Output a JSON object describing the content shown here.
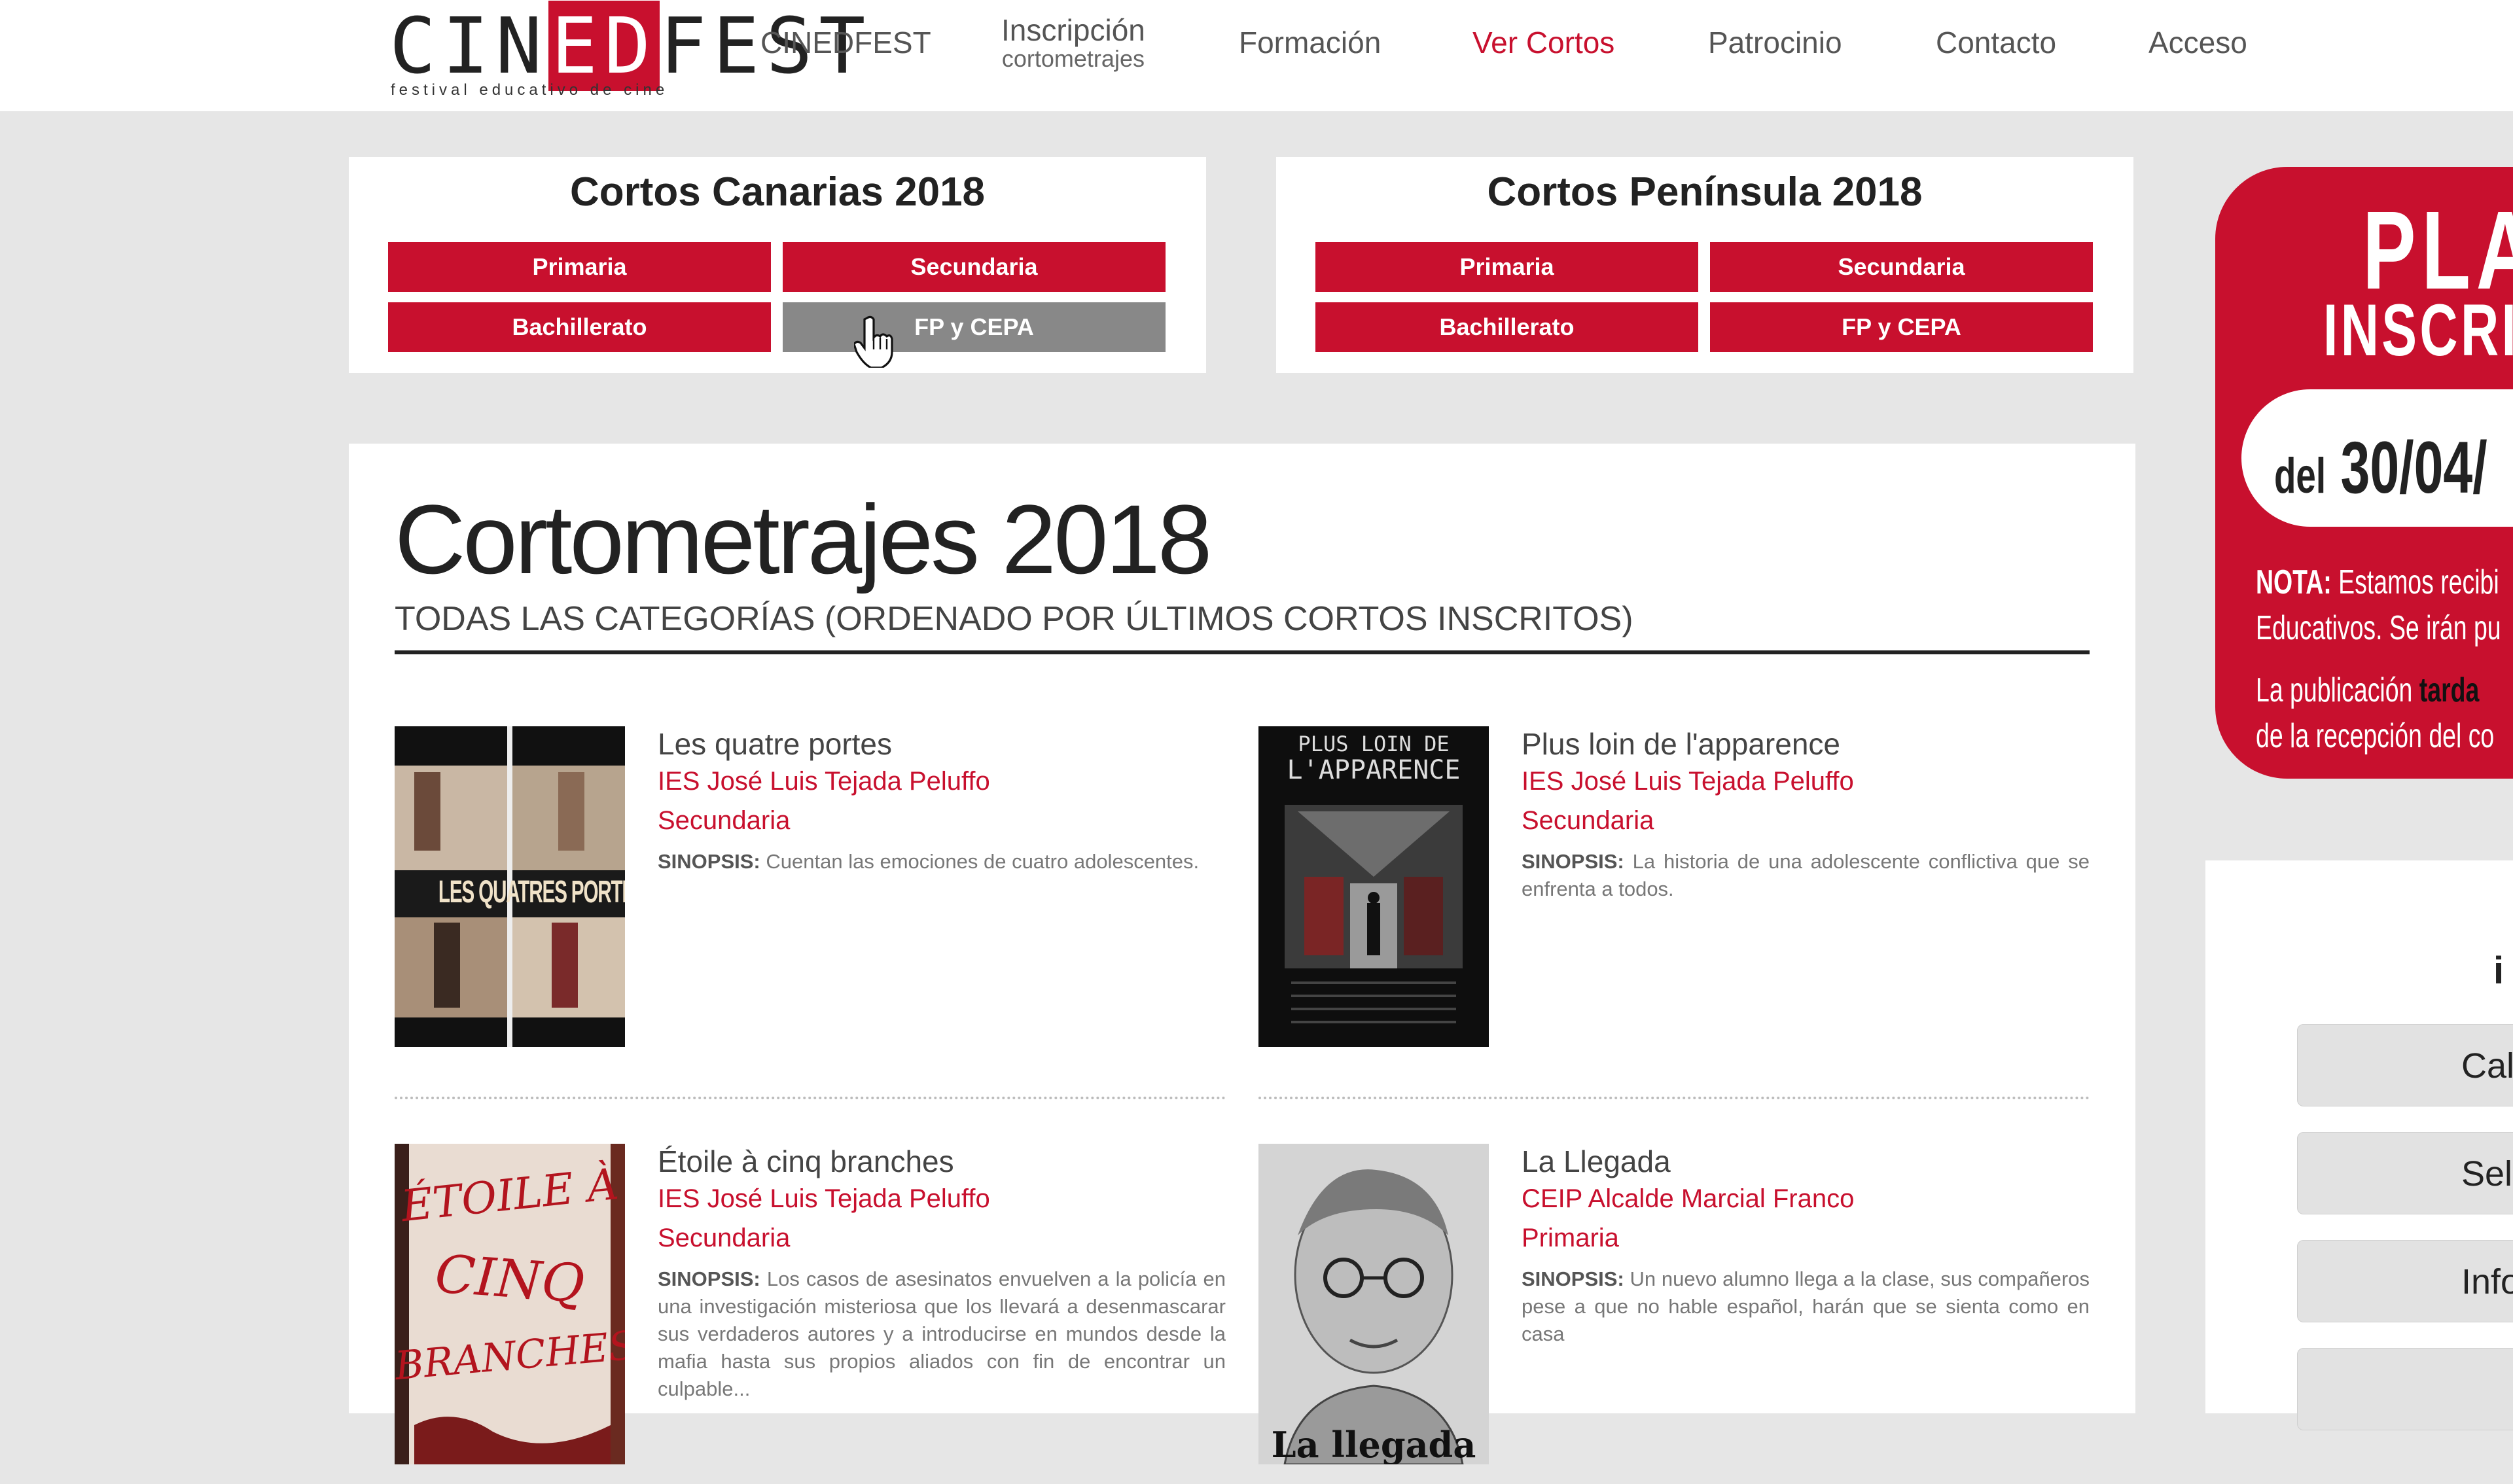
{
  "header": {
    "logo_main_pre": "CIN",
    "logo_main_ed": "ED",
    "logo_main_post": "FEST",
    "logo_sub": "festival educativo de cine",
    "nav": [
      {
        "label": "CINEDFEST"
      },
      {
        "label": "Inscripción",
        "sub": "cortometrajes"
      },
      {
        "label": "Formación"
      },
      {
        "label": "Ver Cortos",
        "active": true
      },
      {
        "label": "Patrocinio"
      },
      {
        "label": "Contacto"
      },
      {
        "label": "Acceso"
      }
    ]
  },
  "panels": [
    {
      "title": "Cortos Canarias 2018",
      "buttons": [
        "Primaria",
        "Secundaria",
        "Bachillerato",
        "FP y CEPA"
      ]
    },
    {
      "title": "Cortos Península 2018",
      "buttons": [
        "Primaria",
        "Secundaria",
        "Bachillerato",
        "FP y CEPA"
      ]
    }
  ],
  "main": {
    "title": "Cortometrajes 2018",
    "subtitle": "TODAS LAS CATEGORÍAS (ORDENADO POR ÚLTIMOS CORTOS INSCRITOS)",
    "synopsis_label": "SINOPSIS:",
    "entries": [
      {
        "title": "Les quatre portes",
        "school": "IES José Luis Tejada Peluffo",
        "level": "Secundaria",
        "synopsis": "Cuentan las emociones de cuatro adolescentes.",
        "poster_text": "LES QUATRES PORTES"
      },
      {
        "title": "Plus loin de l'apparence",
        "school": "IES José Luis Tejada Peluffo",
        "level": "Secundaria",
        "synopsis": "La historia de una adolescente conflictiva que se enfrenta a todos.",
        "poster_text_1": "PLUS LOIN DE",
        "poster_text_2": "L'APPARENCE"
      },
      {
        "title": "Étoile à cinq branches",
        "school": "IES José Luis Tejada Peluffo",
        "level": "Secundaria",
        "synopsis": "Los casos de asesinatos envuelven a la policía en una investigación misteriosa que los llevará a desenmascarar sus verdaderos autores y a introducirse en mundos desde la mafia hasta sus propios aliados con fin de encontrar un culpable...",
        "poster_text_1": "ÉTOILE À",
        "poster_text_2": "CINQ",
        "poster_text_3": "BRANCHES"
      },
      {
        "title": "La Llegada",
        "school": "CEIP Alcalde Marcial Franco",
        "level": "Primaria",
        "synopsis": "Un nuevo alumno llega a la clase, sus compañeros pese a que no hable español, harán que se sienta como en casa",
        "poster_text": "La llegada"
      }
    ]
  },
  "promo": {
    "title": "PLAZ",
    "sub": "INSCRIP",
    "date_prefix": "del",
    "date": "30/04/",
    "note_label": "NOTA:",
    "note_line1": "Estamos recibi",
    "note_line2": "Educativos. Se irán pu",
    "note2_pre": "La publicación",
    "note2_hl": "tarda",
    "note2_line2": "de la recepción del co"
  },
  "sidebar": {
    "heading": "i",
    "buttons": [
      "Cale",
      "Sele",
      "Info",
      ""
    ]
  },
  "colors": {
    "accent": "#c8102e",
    "button_hover": "#888888",
    "page_bg": "#e6e6e6"
  }
}
